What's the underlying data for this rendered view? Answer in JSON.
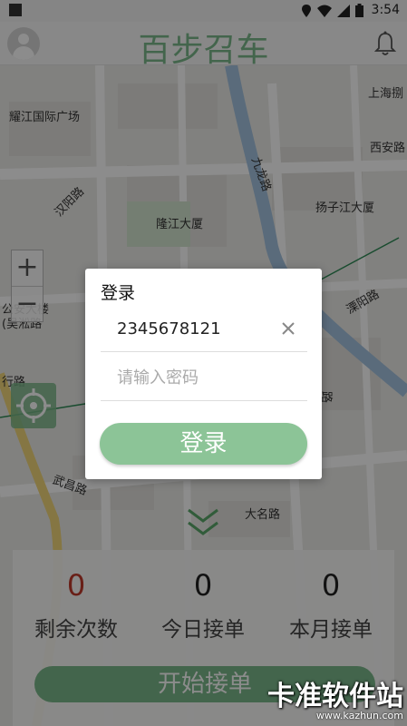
{
  "status_bar": {
    "time": "3:54"
  },
  "header": {
    "title": "百步召车"
  },
  "map": {
    "labels": [
      {
        "id": "label-yaojiang",
        "text": "耀江国际广场"
      },
      {
        "id": "label-shanghai",
        "text": "上海捌"
      },
      {
        "id": "label-xian",
        "text": "西安路"
      },
      {
        "id": "label-hanyang",
        "text": "汉阳路"
      },
      {
        "id": "label-jiulong",
        "text": "九龙路"
      },
      {
        "id": "label-yangzijiang",
        "text": "扬子江大厦"
      },
      {
        "id": "label-longjiang",
        "text": "隆江大厦"
      },
      {
        "id": "label-liyang",
        "text": "溧阳路"
      },
      {
        "id": "label-gongan",
        "text": "公安大楼"
      },
      {
        "id": "label-wusong",
        "text": "(吴淞路"
      },
      {
        "id": "label-xing",
        "text": "行路"
      },
      {
        "id": "label-wuchang",
        "text": "武昌路"
      },
      {
        "id": "label-daming",
        "text": "大名路"
      },
      {
        "id": "label-lu",
        "text": "路"
      }
    ],
    "zoom_in": "+",
    "zoom_out": "−"
  },
  "dialog": {
    "title": "登录",
    "phone_value": "2345678121",
    "password_placeholder": "请输入密码",
    "login_label": "登录"
  },
  "stats": [
    {
      "value": "0",
      "label": "剩余次数",
      "color": "#c0392b"
    },
    {
      "value": "0",
      "label": "今日接单",
      "color": "#222222"
    },
    {
      "value": "0",
      "label": "本月接单",
      "color": "#222222"
    }
  ],
  "start_button": "开始接单",
  "watermark": {
    "main": "卡准软件站",
    "url": "www.kazhun.com"
  },
  "colors": {
    "accent": "#7bb88a"
  }
}
